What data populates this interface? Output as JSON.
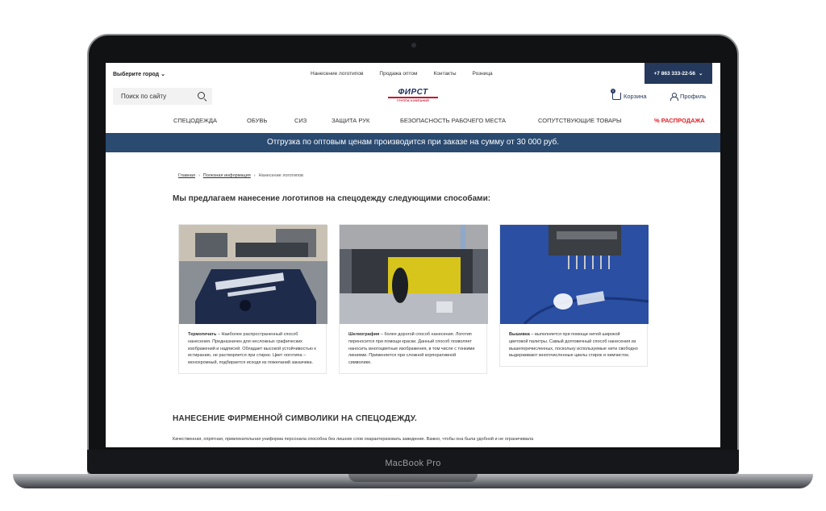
{
  "device": {
    "label": "MacBook Pro"
  },
  "topbar": {
    "city": "Выберите город",
    "links": [
      "Нанесение логотипов",
      "Продажа оптом",
      "Контакты",
      "Розница"
    ],
    "phone": "+7 863 333-22-56"
  },
  "header": {
    "search_placeholder": "Поиск по сайту",
    "logo_text": "ФИРСТ",
    "logo_sub": "ГРУППА КОМПАНИЙ",
    "cart_label": "Корзина",
    "cart_count": "0",
    "profile_label": "Профиль"
  },
  "nav": {
    "items": [
      "СПЕЦОДЕЖДА",
      "ОБУВЬ",
      "СИЗ",
      "ЗАЩИТА РУК",
      "БЕЗОПАСНОСТЬ РАБОЧЕГО МЕСТА",
      "СОПУТСТВУЮЩИЕ ТОВАРЫ",
      "% РАСПРОДАЖА"
    ]
  },
  "banner": {
    "text": "Отгрузка по оптовым ценам производится при заказе на сумму от 30 000 руб."
  },
  "breadcrumb": {
    "home": "Главная",
    "section": "Полезная информация",
    "current": "Нанесение логотипов"
  },
  "content": {
    "heading": "Мы предлагаем нанесение логотипов на спецодежду следующими способами:",
    "cards": [
      {
        "title": "Термопечать",
        "text": " – Наиболее распространенный способ нанесения. Предназначен для несложных графических изображений и надписей. Обладает высокой устойчивостью к истиранию, не растворяется при стирке. Цвет логотипа – монохромный, подбирается исходя из пожеланий заказчика."
      },
      {
        "title": "Шелкография",
        "text": " – более дорогой способ нанесения. Логотип переносится при помощи краски. Данный способ позволяет наносить многоцветные изображения, в том числе с тонкими линиями. Применяется при сложной корпоративной символике."
      },
      {
        "title": "Вышивка",
        "text": " – выполняется при помощи нитей широкой цветовой палитры. Самый долговечный способ нанесения из вышеперечисленных, поскольку используемые нити свободно выдерживают многочисленные циклы стирок и химчисток."
      }
    ],
    "subheading": "НАНЕСЕНИЕ ФИРМЕННОЙ СИМВОЛИКИ НА СПЕЦОДЕЖДУ.",
    "paragraph": "Качественная, опрятная, привлекательная униформа персонала способна без лишних слов охарактеризовать заведение. Важно, чтобы она была удобной и не ограничивала"
  },
  "colors": {
    "brand_navy": "#24395c",
    "banner_blue": "#2a4a70",
    "sale_red": "#e31e24"
  }
}
